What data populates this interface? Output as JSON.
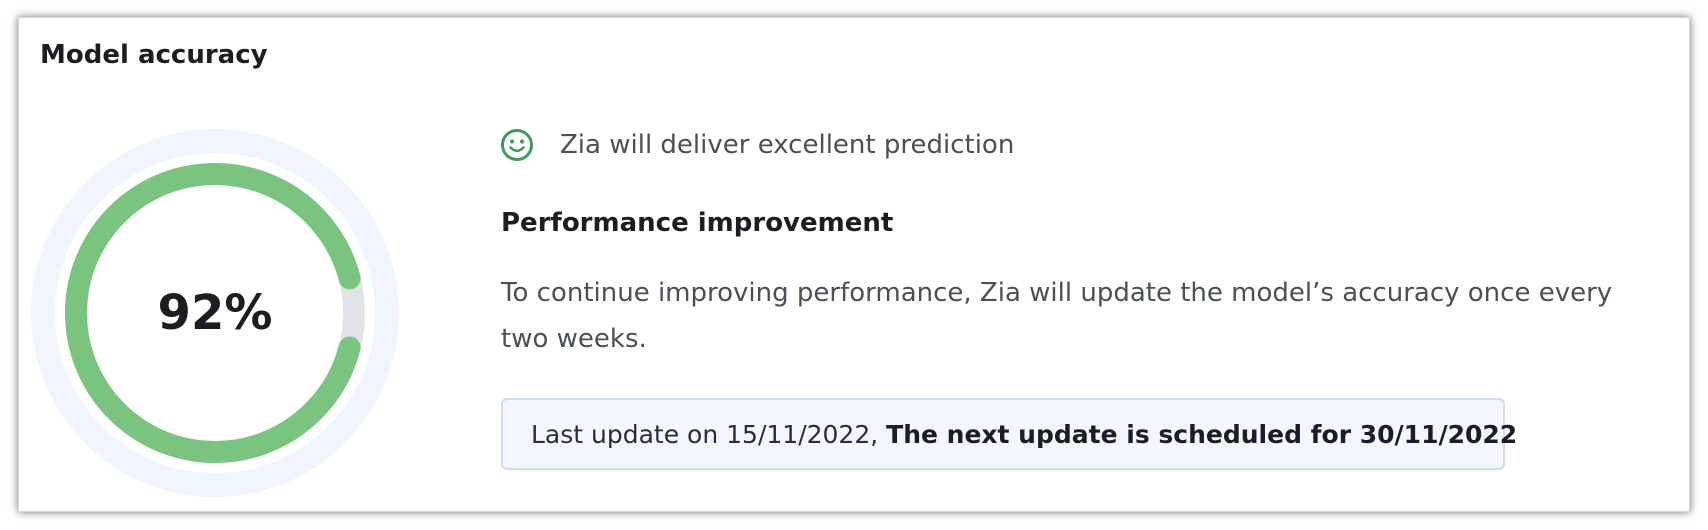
{
  "card": {
    "title": "Model accuracy"
  },
  "gauge": {
    "value_label": "92%",
    "percent": 92,
    "color_fill": "#7ac47f",
    "color_track": "#e1e3e8",
    "color_halo": "#f0f4fc"
  },
  "status": {
    "icon": "smiley-face-icon",
    "icon_color": "#3f9a5c",
    "text": "Zia will deliver excellent prediction"
  },
  "performance": {
    "heading": "Performance improvement",
    "description": "To continue improving performance, Zia will update the model’s accuracy once every two weeks."
  },
  "update_info": {
    "last_update": "Last update on 15/11/2022,",
    "next_update": "The next update is scheduled for 30/11/2022",
    "background": "#f2f6fd",
    "border": "#cfdcef"
  }
}
